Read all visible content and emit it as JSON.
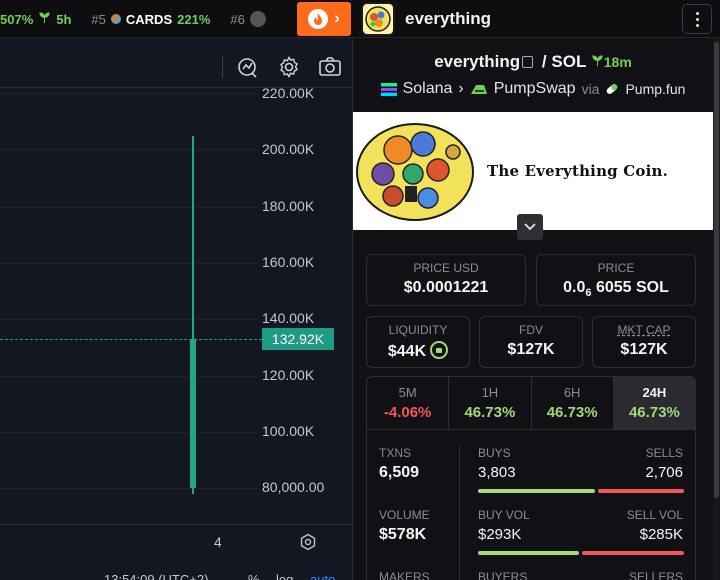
{
  "ticker": {
    "item1_pct": "507%",
    "item1_age": "5h",
    "item2_rank": "#5",
    "item2_symbol": "CARDS",
    "item2_pct": "221%",
    "item3_rank": "#6"
  },
  "header": {
    "token_name": "everything"
  },
  "chart": {
    "y_ticks": [
      "220.00K",
      "200.00K",
      "180.00K",
      "160.00K",
      "140.00K",
      "120.00K",
      "100.00K",
      "80,000.00"
    ],
    "current_price_label": "132.92K",
    "x_tick": "4",
    "bottom_time": "13:54:09 (UTC+2)",
    "bottom_pct": "%",
    "bottom_log": "log",
    "bottom_auto": "auto",
    "colors": {
      "up": "#22a589",
      "price_tag": "#1f9a84"
    }
  },
  "chart_data": {
    "type": "candlestick",
    "ylim": [
      70000,
      225000
    ],
    "current_price": 132920,
    "candles": [
      {
        "x": "4",
        "open": 80000,
        "close": 132920,
        "high": 205000,
        "low": 78000
      }
    ]
  },
  "pair": {
    "base": "everything",
    "sep": "/",
    "quote": "SOL",
    "age": "18m"
  },
  "chain": {
    "chain_name": "Solana",
    "dex": "PumpSwap",
    "via": "via",
    "launchpad": "Pump.fun"
  },
  "banner": {
    "tagline": "The Everything Coin."
  },
  "metrics": {
    "price_usd_label": "PRICE USD",
    "price_usd": "$0.0001221",
    "price_label": "PRICE",
    "price_sol_prefix": "0.0",
    "price_sol_sub": "6",
    "price_sol_rest": "6055 SOL",
    "liquidity_label": "LIQUIDITY",
    "liquidity": "$44K",
    "fdv_label": "FDV",
    "fdv": "$127K",
    "mcap_label": "MKT CAP",
    "mcap": "$127K"
  },
  "tabs": [
    {
      "label": "5M",
      "value": "-4.06%",
      "dir": "neg"
    },
    {
      "label": "1H",
      "value": "46.73%",
      "dir": "pos"
    },
    {
      "label": "6H",
      "value": "46.73%",
      "dir": "pos"
    },
    {
      "label": "24H",
      "value": "46.73%",
      "dir": "pos"
    }
  ],
  "stats": {
    "txns_label": "TXNS",
    "txns": "6,509",
    "buys_label": "BUYS",
    "buys": "3,803",
    "sells_label": "SELLS",
    "sells": "2,706",
    "buys_ratio": 0.584,
    "volume_label": "VOLUME",
    "volume": "$578K",
    "buy_vol_label": "BUY VOL",
    "buy_vol": "$293K",
    "sell_vol_label": "SELL VOL",
    "sell_vol": "$285K",
    "buy_vol_ratio": 0.507,
    "makers_label": "MAKERS",
    "buyers_label": "BUYERS",
    "sellers_label": "SELLERS",
    "colors": {
      "buy": "#a3d977",
      "sell": "#f2555a"
    }
  }
}
